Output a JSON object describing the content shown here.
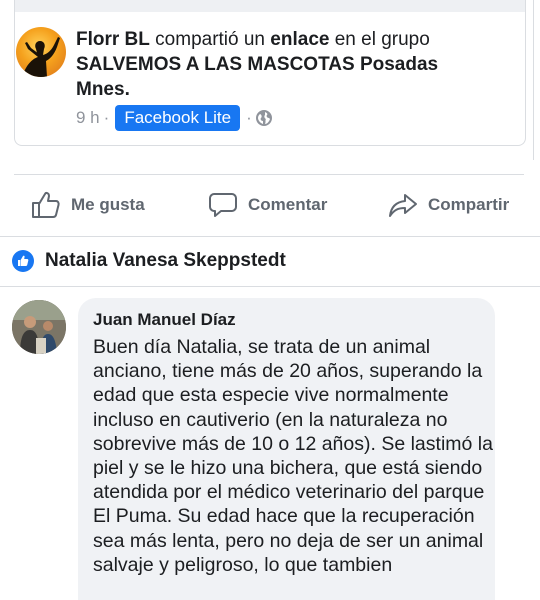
{
  "shared_post": {
    "sharer_name": "Florr BL",
    "action_text": " compartió un ",
    "link_word": "enlace",
    "group_prefix": " en el grupo ",
    "group_name": "SALVEMOS A LAS MASCOTAS Posadas Mnes.",
    "time": "9 h",
    "dot1": "·",
    "source_badge": "Facebook Lite",
    "dot2": "·",
    "privacy_icon": "globe-icon"
  },
  "actions": {
    "like_label": "Me gusta",
    "comment_label": "Comentar",
    "share_label": "Compartir"
  },
  "likers": {
    "name": "Natalia Vanesa Skeppstedt",
    "icon": "thumbs-up-icon"
  },
  "comment": {
    "author": "Juan Manuel Díaz",
    "text": "Buen día Natalia, se trata de un animal anciano, tiene más de 20 años, superando la edad que esta especie vive normalmente incluso en cautiverio (en la naturaleza no sobrevive más de 10 o 12 años). Se lastimó la piel y se le hizo una bichera, que está siendo atendida por el médico veterinario del parque El Puma. Su edad hace que la recuperación sea más lenta, pero no deja de ser un animal salvaje y peligroso, lo que tambien"
  },
  "colors": {
    "facebook_blue": "#1877f2",
    "muted_text": "#606770",
    "bubble_bg": "#f0f2f5"
  }
}
